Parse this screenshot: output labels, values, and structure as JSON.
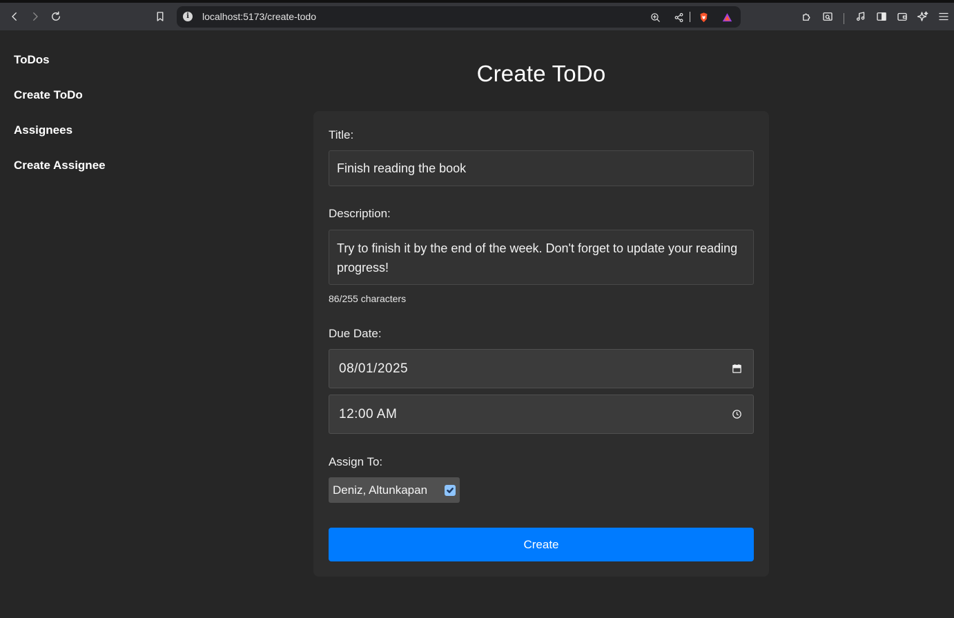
{
  "browser": {
    "url": "localhost:5173/create-todo",
    "brand_color": "#fb542b"
  },
  "sidebar": {
    "items": [
      {
        "label": "ToDos"
      },
      {
        "label": "Create ToDo"
      },
      {
        "label": "Assignees"
      },
      {
        "label": "Create Assignee"
      }
    ]
  },
  "page": {
    "title": "Create ToDo"
  },
  "form": {
    "title_label": "Title:",
    "title_value": "Finish reading the book",
    "description_label": "Description:",
    "description_value": "Try to finish it by the end of the week. Don't forget to update your reading progress!",
    "char_count": "86/255 characters",
    "due_date_label": "Due Date:",
    "due_date_value": "08/01/2025",
    "due_time_value": "12:00 AM",
    "assign_label": "Assign To:",
    "assignees": [
      {
        "name": "Deniz, Altunkapan",
        "checked": true
      }
    ],
    "submit_label": "Create",
    "accent_color": "#007bff"
  }
}
